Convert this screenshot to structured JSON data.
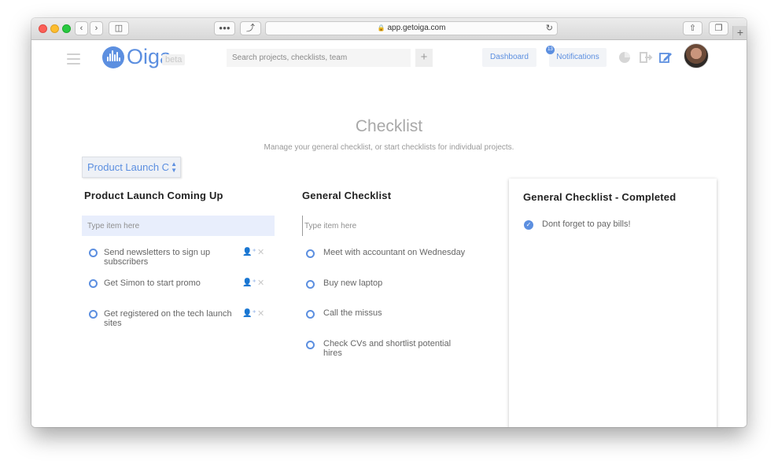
{
  "browser": {
    "url": "app.getoiga.com"
  },
  "header": {
    "logo_text": "Oiga",
    "beta_label": "beta",
    "search_placeholder": "Search projects, checklists, team",
    "add_label": "+",
    "dashboard_label": "Dashboard",
    "notifications_label": "Notifications",
    "notifications_count": "13",
    "icons": [
      "menu-icon",
      "pie-chart-icon",
      "logout-icon",
      "edit-icon",
      "avatar"
    ]
  },
  "page": {
    "title": "Checklist",
    "subtitle": "Manage your general checklist, or start checklists for individual projects.",
    "project_select_value": "Product Launch C"
  },
  "project_column": {
    "title": "Product Launch Coming Up",
    "input_placeholder": "Type item here",
    "items": [
      {
        "line1": "Send newsletters to sign up",
        "line2": "subscribers"
      },
      {
        "line1": "Get Simon to start promo",
        "line2": ""
      },
      {
        "line1": "Get registered on the tech launch",
        "line2": "sites"
      }
    ]
  },
  "general_column": {
    "title": "General Checklist",
    "input_placeholder": "Type item here",
    "items": [
      {
        "line1": "Meet with accountant on Wednesday",
        "line2": ""
      },
      {
        "line1": "Buy new laptop",
        "line2": ""
      },
      {
        "line1": "Call the missus",
        "line2": ""
      },
      {
        "line1": "Check CVs and shortlist potential",
        "line2": "hires"
      }
    ]
  },
  "completed_panel": {
    "title": "General Checklist - Completed",
    "items": [
      {
        "label": "Dont forget to pay bills!"
      }
    ]
  },
  "colors": {
    "accent": "#5c8fe0",
    "input_highlight": "#e8eefc"
  }
}
